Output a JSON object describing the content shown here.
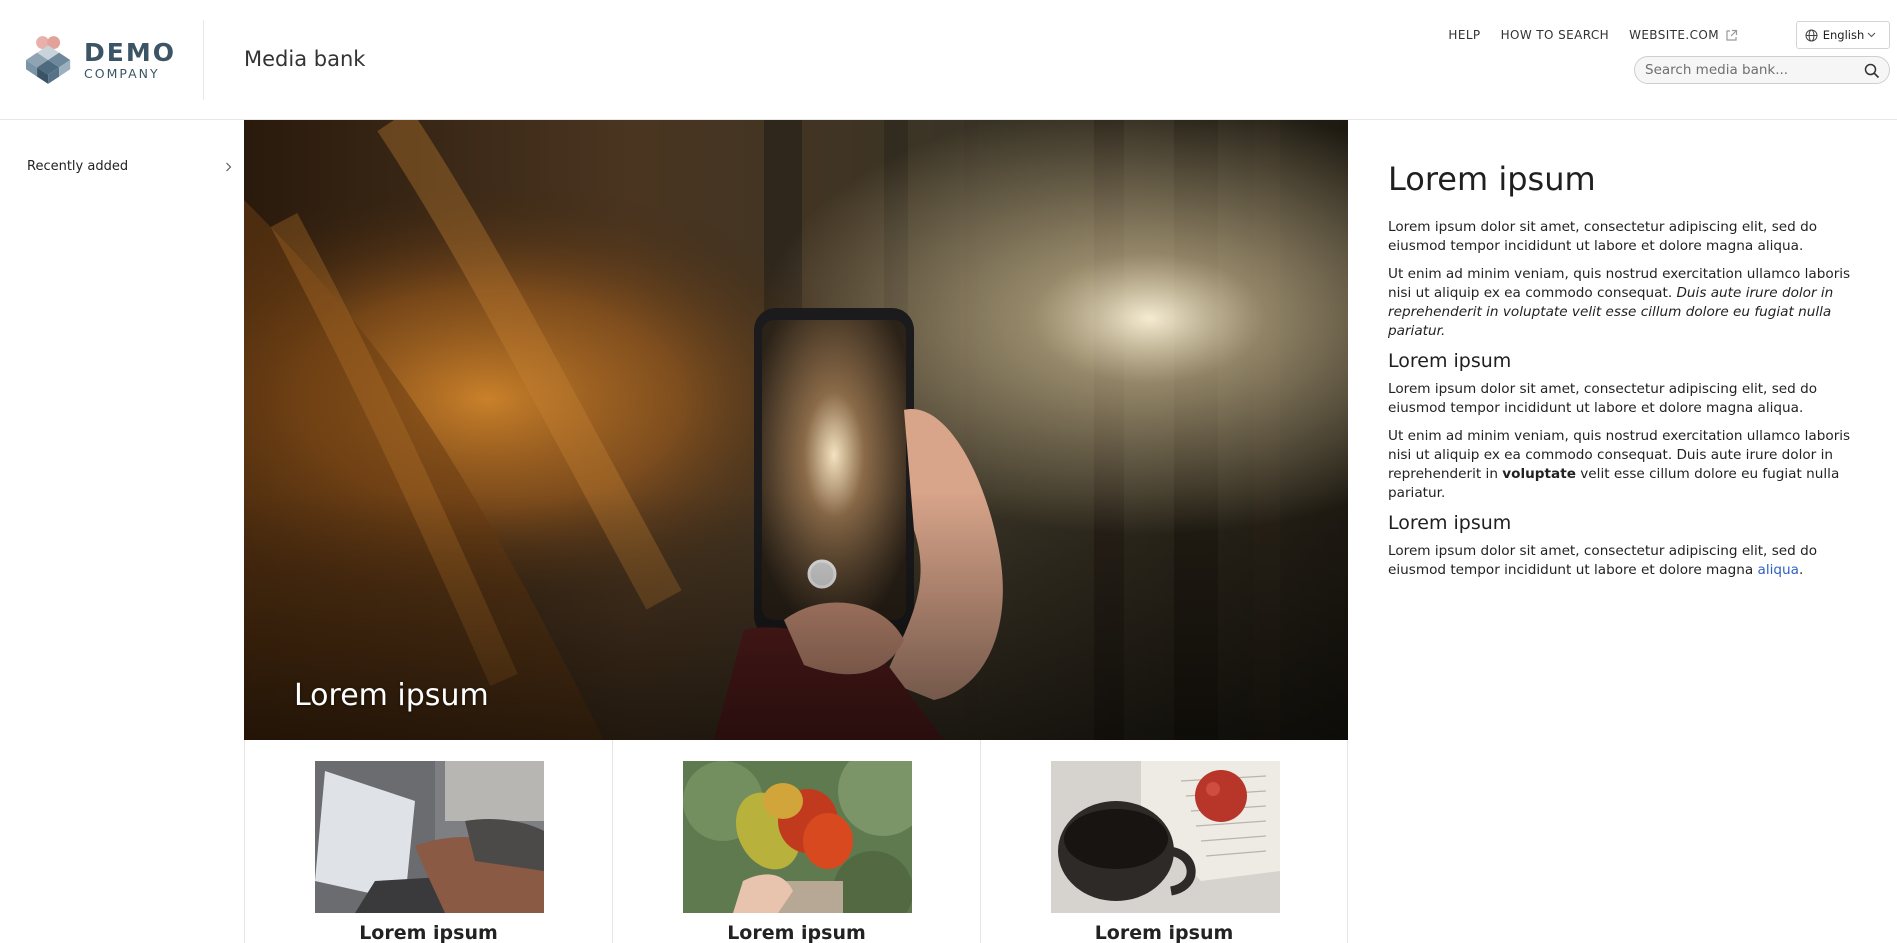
{
  "header": {
    "logo_line1": "DEMO",
    "logo_line2": "COMPANY",
    "site_title": "Media bank",
    "nav": [
      {
        "label": "HELP"
      },
      {
        "label": "HOW TO SEARCH"
      },
      {
        "label": "WEBSITE.COM",
        "icon": "external-link-icon"
      }
    ],
    "language": "English",
    "search_placeholder": "Search media bank..."
  },
  "sidebar": {
    "items": [
      {
        "label": "Recently added",
        "icon": "chevron-right-icon"
      }
    ]
  },
  "hero": {
    "caption": "Lorem ipsum"
  },
  "cards": [
    {
      "title": "Lorem ipsum"
    },
    {
      "title": "Lorem ipsum"
    },
    {
      "title": "Lorem ipsum"
    }
  ],
  "article": {
    "title": "Lorem ipsum",
    "p1": "Lorem ipsum dolor sit amet, consectetur adipiscing elit, sed do eiusmod tempor incididunt ut labore et dolore magna aliqua.",
    "p2_normal": "Ut enim ad minim veniam, quis nostrud exercitation ullamco laboris nisi ut aliquip ex ea commodo consequat. ",
    "p2_italic": "Duis aute irure dolor in reprehenderit in voluptate velit esse cillum dolore eu fugiat nulla pariatur.",
    "h2_a": "Lorem ipsum",
    "p3": "Lorem ipsum dolor sit amet, consectetur adipiscing elit, sed do eiusmod tempor incididunt ut labore et dolore magna aliqua.",
    "p4_before": "Ut enim ad minim veniam, quis nostrud exercitation ullamco laboris nisi ut aliquip ex ea commodo consequat. Duis aute irure dolor in reprehenderit in ",
    "p4_bold": "voluptate",
    "p4_after": " velit esse cillum dolore eu fugiat nulla pariatur.",
    "h2_b": "Lorem ipsum",
    "p5_before": "Lorem ipsum dolor sit amet, consectetur adipiscing elit, sed do eiusmod tempor incididunt ut labore et dolore magna ",
    "p5_link": "aliqua",
    "p5_after": "."
  },
  "colors": {
    "logo_text": "#3c5566",
    "link": "#2f5fc2"
  }
}
